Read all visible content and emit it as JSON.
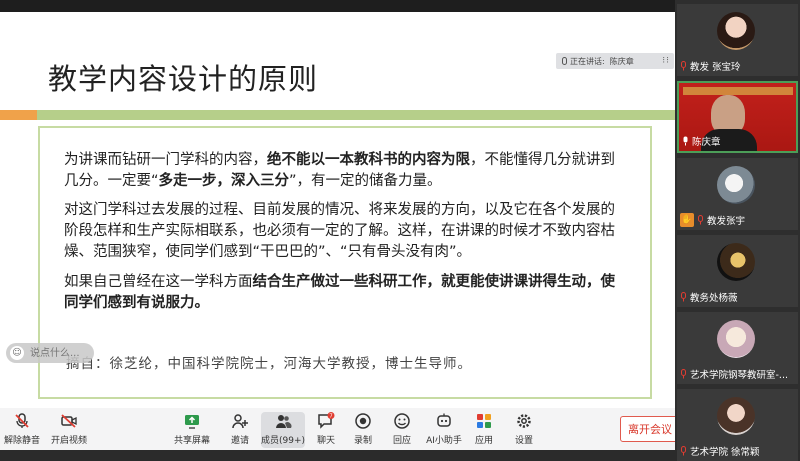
{
  "slide": {
    "title": "教学内容设计的原则",
    "paragraphs": [
      {
        "segments": [
          {
            "text": "为讲课而钻研一门学科的内容，",
            "bold": false
          },
          {
            "text": "绝不能以一本教科书的内容为限",
            "bold": true
          },
          {
            "text": "，不能懂得几分就讲到几分。一定要“",
            "bold": false
          },
          {
            "text": "多走一步，深入三分",
            "bold": true
          },
          {
            "text": "”，有一定的储备力量。",
            "bold": false
          }
        ]
      },
      {
        "segments": [
          {
            "text": "对这门学科过去发展的过程、目前发展的情况、将来发展的方向，以及它在各个发展的阶段怎样和生产实际相联系，也必须有一定的了解。这样，在讲课的时候才不致内容枯燥、范围狭窄，使同学们感到“干巴巴的”、“只有骨头没有肉”。",
            "bold": false
          }
        ]
      },
      {
        "segments": [
          {
            "text": "如果自己曾经在这一学科方面",
            "bold": false
          },
          {
            "text": "结合生产做过一些科研工作，就更能使讲课讲得生动，使同学们感到有说服力。",
            "bold": true
          }
        ]
      }
    ],
    "citation": "摘自：徐芝纶，中国科学院院士，河海大学教授，博士生导师。",
    "accent_orange": "#f0a24a",
    "accent_green": "#b6cf8a"
  },
  "speaker": {
    "label": "正在讲话:",
    "name": "陈庆章"
  },
  "chat": {
    "placeholder": "说点什么..."
  },
  "toolbar": {
    "buttons": [
      {
        "label": "解除静音",
        "icon": "mic-muted-icon"
      },
      {
        "label": "开启视频",
        "icon": "video-off-icon"
      },
      {
        "label": "共享屏幕",
        "icon": "share-screen-icon"
      },
      {
        "label": "邀请",
        "icon": "invite-icon"
      },
      {
        "label": "成员(99+)",
        "icon": "members-icon"
      },
      {
        "label": "聊天",
        "icon": "chat-icon",
        "badge": "7"
      },
      {
        "label": "录制",
        "icon": "record-icon"
      },
      {
        "label": "回应",
        "icon": "reaction-icon"
      },
      {
        "label": "AI小助手",
        "icon": "ai-assistant-icon"
      },
      {
        "label": "应用",
        "icon": "apps-icon"
      },
      {
        "label": "设置",
        "icon": "settings-icon"
      }
    ],
    "leave": "离开会议"
  },
  "participants": [
    {
      "name": "教发 张宝玲"
    },
    {
      "name": "陈庆章"
    },
    {
      "name": "教发张宇"
    },
    {
      "name": "教务处杨薇"
    },
    {
      "name": "艺术学院钢琴教研室-..."
    },
    {
      "name": "艺术学院 徐常颖"
    }
  ],
  "colors": {
    "leave_red": "#d8372a",
    "active_border": "#4c9e58",
    "muted_mic": "#e03c31"
  }
}
